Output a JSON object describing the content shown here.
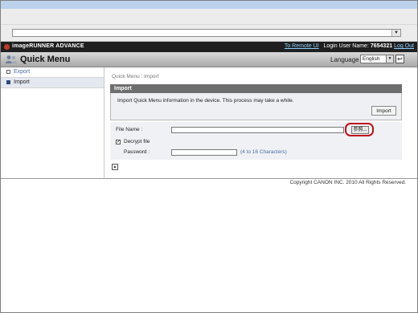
{
  "header": {
    "product_name": "imageRUNNER ADVANCE",
    "remote_link": "To Remote UI",
    "login_label": "Login User Name:",
    "login_user": "7654321",
    "logout_link": "Log Out"
  },
  "page": {
    "title": "Quick Menu",
    "language_label": "Language",
    "language_value": "English"
  },
  "sidebar": {
    "items": [
      {
        "label": "Export",
        "selected": false
      },
      {
        "label": "Import",
        "selected": true
      }
    ]
  },
  "content": {
    "breadcrumb": "Quick Menu : Import",
    "panel_title": "Import",
    "panel_description": "Import Quick Menu information in the device. This process may take a while.",
    "import_button": "Import",
    "file_name_label": "File Name :",
    "browse_button": "参照...",
    "decrypt_label": "Decrypt file",
    "decrypt_checked": true,
    "password_label": "Password :",
    "password_hint": "(4 to 16 Characters)"
  },
  "footer": {
    "copyright": "Copyright CANON INC. 2010 All Rights Reserved."
  },
  "colors": {
    "accent_link": "#4a6ea8",
    "header_bar": "#1f1f1f",
    "highlight": "#c0101a"
  }
}
